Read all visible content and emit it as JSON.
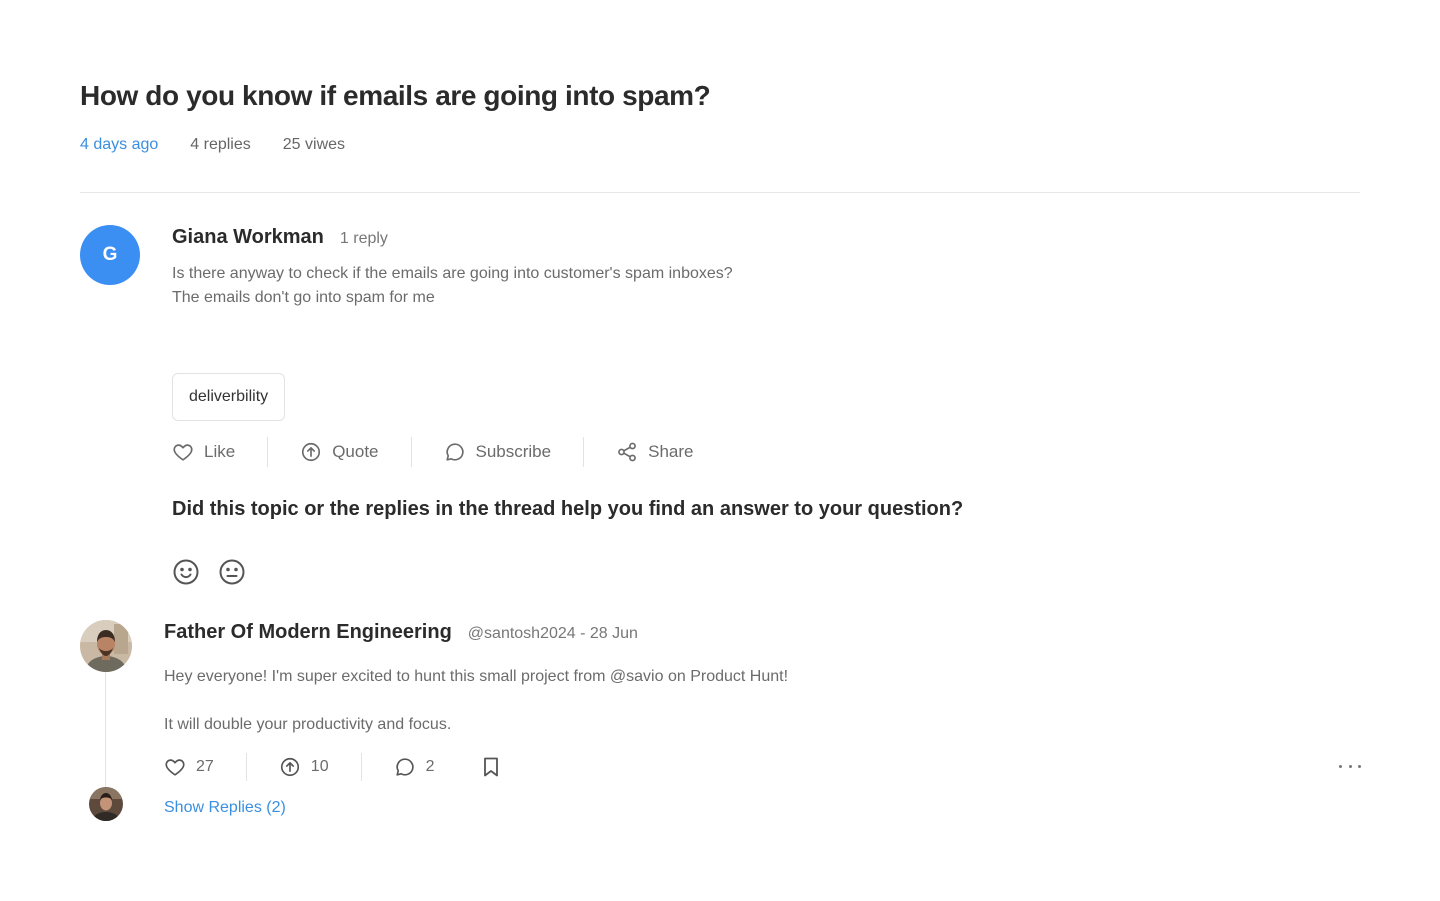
{
  "topic": {
    "title": "How do you know if emails are going into spam?",
    "time_ago": "4 days ago",
    "replies": "4 replies",
    "views": "25 viwes"
  },
  "post": {
    "avatar_initial": "G",
    "author": "Giana Workman",
    "reply_count": "1 reply",
    "lines": [
      "Is there anyway to check if the emails are going into customer's spam inboxes?",
      "The emails don't go into spam for me"
    ],
    "tag": "deliverbility",
    "actions": {
      "like": "Like",
      "quote": "Quote",
      "subscribe": "Subscribe",
      "share": "Share"
    }
  },
  "feedback": {
    "question": "Did this topic or the replies in the thread help you find an answer to your question?",
    "options": [
      "smile-face-icon",
      "neutral-face-icon"
    ]
  },
  "reply": {
    "author": "Father Of Modern Engineering",
    "handle_date": "@santosh2024 - 28 Jun",
    "paragraphs": [
      "Hey everyone! I'm super excited to hunt this small project from @savio on Product Hunt!",
      "It will double your productivity and focus."
    ],
    "likes": "27",
    "upvotes": "10",
    "comments": "2",
    "show_replies": "Show Replies (2)"
  },
  "colors": {
    "accent": "#3b8fe0",
    "avatar_bg": "#3b8ff3",
    "text_primary": "#2b2b2b",
    "text_secondary": "#6b6b6b",
    "border": "#e3e3e3"
  }
}
